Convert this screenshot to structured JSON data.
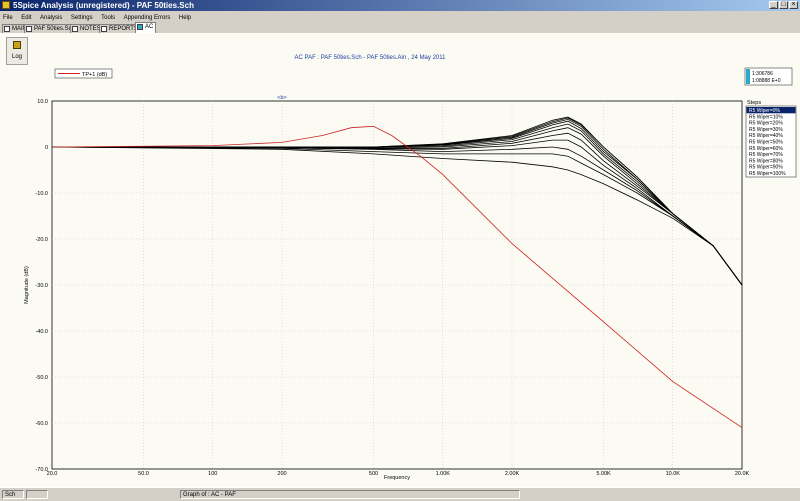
{
  "window": {
    "title": "5Spice Analysis (unregistered) - PAF 50ties.Sch"
  },
  "menu": [
    "File",
    "Edit",
    "Analysis",
    "Settings",
    "Tools",
    "Appending Errors",
    "Help"
  ],
  "tabs": [
    "MAIN",
    "PAF 50ties.Sch",
    "NOTES",
    "REPORTS",
    "AC"
  ],
  "toolbar": {
    "log_label": "Log"
  },
  "plot": {
    "title": "AC PAF : PAF 50ties.Sch - PAF 50ties.Ain , 24 May 2011",
    "marker_label": "<b>",
    "legend_trace": "TP+1 (dB)",
    "cursor_1": "1:306786",
    "cursor_2": "1:08888 E+0"
  },
  "steps_panel": {
    "header": "Steps",
    "items": [
      "R5 Wiper=0%",
      "R5 Wiper=10%",
      "R5 Wiper=20%",
      "R5 Wiper=30%",
      "R5 Wiper=40%",
      "R5 Wiper=50%",
      "R5 Wiper=60%",
      "R5 Wiper=70%",
      "R5 Wiper=80%",
      "R5 Wiper=90%",
      "R5 Wiper=100%"
    ]
  },
  "statusbar": {
    "tab": "Sch",
    "graph": "Graph of : AC - PAF"
  },
  "colors": {
    "trace_red": "#cc2222",
    "trace_black": "#000000",
    "plot_bg": "#fbfbf3",
    "selected": "#0a246a"
  },
  "chart_data": {
    "type": "line",
    "xscale": "log",
    "xlim": [
      20,
      20000
    ],
    "ylim": [
      -70,
      10
    ],
    "xlabel": "Frequency",
    "ylabel": "Magnitude (dB)",
    "xticks": [
      20,
      50,
      100,
      200,
      500,
      1000,
      2000,
      5000,
      10000,
      20000
    ],
    "xtick_labels": [
      "20.0",
      "50.0",
      "100",
      "200",
      "500",
      "1.00K",
      "2.00K",
      "5.00K",
      "10.0K",
      "20.0K"
    ],
    "yticks": [
      10,
      0,
      -10,
      -20,
      -30,
      -40,
      -50,
      -60,
      -70
    ],
    "ytick_labels": [
      "10.0",
      "0",
      "-10.0",
      "-20.0",
      "-30.0",
      "-40.0",
      "-50.0",
      "-60.0",
      "-70.0"
    ],
    "series": [
      {
        "name": "TP+1 (dB)",
        "color": "#cc2222",
        "x": [
          20,
          100,
          200,
          300,
          400,
          500,
          600,
          800,
          1000,
          2000,
          5000,
          10000,
          20000
        ],
        "y": [
          0,
          0.3,
          1,
          2.5,
          4.2,
          4.5,
          2.5,
          -2,
          -6,
          -21,
          -38,
          -51,
          -61
        ]
      },
      {
        "name": "R5 Wiper=0%",
        "color": "#000000",
        "x": [
          20,
          200,
          500,
          1000,
          2000,
          3000,
          3500,
          4000,
          5000,
          7000,
          10000,
          15000,
          20000
        ],
        "y": [
          0,
          -0.5,
          -1.5,
          -2.5,
          -3.3,
          -4.3,
          -5,
          -6,
          -8,
          -11.5,
          -15.5,
          -21.5,
          -30
        ]
      },
      {
        "name": "R5 Wiper=10%",
        "color": "#000000",
        "x": [
          20,
          200,
          500,
          1000,
          2000,
          3000,
          3500,
          4000,
          5000,
          7000,
          10000,
          15000,
          20000
        ],
        "y": [
          0,
          -0.3,
          -1,
          -1.5,
          -1.5,
          -1.5,
          -2,
          -3.5,
          -6,
          -10,
          -15,
          -21.5,
          -30
        ]
      },
      {
        "name": "R5 Wiper=20%",
        "color": "#000000",
        "x": [
          20,
          200,
          500,
          1000,
          2000,
          3000,
          3500,
          4000,
          5000,
          7000,
          10000,
          15000,
          20000
        ],
        "y": [
          0,
          -0.2,
          -0.5,
          -1,
          -0.5,
          0,
          -0.5,
          -2,
          -5,
          -9.5,
          -15,
          -21.5,
          -30
        ]
      },
      {
        "name": "R5 Wiper=30%",
        "color": "#000000",
        "x": [
          20,
          200,
          500,
          1000,
          2000,
          3000,
          3500,
          4000,
          5000,
          7000,
          10000,
          15000,
          20000
        ],
        "y": [
          0,
          -0.2,
          -0.4,
          -0.5,
          0.3,
          1.5,
          1.5,
          0,
          -4,
          -9,
          -15,
          -21.5,
          -30
        ]
      },
      {
        "name": "R5 Wiper=40%",
        "color": "#000000",
        "x": [
          20,
          200,
          500,
          1000,
          2000,
          3000,
          3500,
          4000,
          5000,
          7000,
          10000,
          15000,
          20000
        ],
        "y": [
          0,
          -0.1,
          -0.3,
          -0.3,
          0.8,
          2.5,
          3,
          1.5,
          -3,
          -8.5,
          -14.5,
          -21.5,
          -30
        ]
      },
      {
        "name": "R5 Wiper=50%",
        "color": "#000000",
        "x": [
          20,
          200,
          500,
          1000,
          2000,
          3000,
          3500,
          4000,
          5000,
          7000,
          10000,
          15000,
          20000
        ],
        "y": [
          0,
          0,
          -0.2,
          0,
          1.2,
          3.5,
          4.2,
          2.8,
          -2,
          -8,
          -14.5,
          -21.5,
          -30
        ]
      },
      {
        "name": "R5 Wiper=60%",
        "color": "#000000",
        "x": [
          20,
          200,
          500,
          1000,
          2000,
          3000,
          3500,
          4000,
          5000,
          7000,
          10000,
          15000,
          20000
        ],
        "y": [
          0,
          0,
          0,
          0.2,
          1.6,
          4.2,
          5,
          3.5,
          -1.5,
          -7.5,
          -14.5,
          -21.5,
          -30
        ]
      },
      {
        "name": "R5 Wiper=70%",
        "color": "#000000",
        "x": [
          20,
          200,
          500,
          1000,
          2000,
          3000,
          3500,
          4000,
          5000,
          7000,
          10000,
          15000,
          20000
        ],
        "y": [
          0,
          0,
          0,
          0.4,
          1.9,
          4.8,
          5.6,
          4,
          -1,
          -7,
          -14.5,
          -21.5,
          -30
        ]
      },
      {
        "name": "R5 Wiper=80%",
        "color": "#000000",
        "x": [
          20,
          200,
          500,
          1000,
          2000,
          3000,
          3500,
          4000,
          5000,
          7000,
          10000,
          15000,
          20000
        ],
        "y": [
          0,
          0,
          0,
          0.5,
          2.1,
          5.2,
          6,
          4.5,
          -0.5,
          -7,
          -14.5,
          -21.5,
          -30
        ]
      },
      {
        "name": "R5 Wiper=90%",
        "color": "#000000",
        "x": [
          20,
          200,
          500,
          1000,
          2000,
          3000,
          3500,
          4000,
          5000,
          7000,
          10000,
          15000,
          20000
        ],
        "y": [
          0,
          0,
          0,
          0.6,
          2.3,
          5.5,
          6.3,
          4.8,
          0,
          -6.5,
          -14.5,
          -21.5,
          -30
        ]
      },
      {
        "name": "R5 Wiper=100%",
        "color": "#000000",
        "x": [
          20,
          200,
          500,
          1000,
          2000,
          3000,
          3500,
          4000,
          5000,
          7000,
          10000,
          15000,
          20000
        ],
        "y": [
          0,
          0,
          0,
          0.7,
          2.5,
          5.8,
          6.5,
          5,
          0,
          -6.5,
          -14.5,
          -21.5,
          -30
        ]
      }
    ]
  }
}
